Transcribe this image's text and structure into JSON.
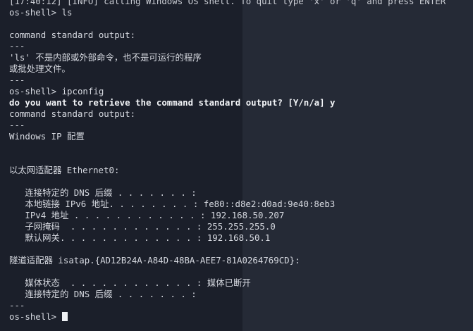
{
  "terminal": {
    "lines": [
      "[17:40:12] [INFO] calling Windows OS shell. To quit type 'x' or 'q' and press ENTER",
      "os-shell> ls",
      "",
      "command standard output:",
      "---",
      "'ls' 不是内部或外部命令，也不是可运行的程序",
      "或批处理文件。",
      "---",
      "os-shell> ipconfig",
      "do you want to retrieve the command standard output? [Y/n/a] y",
      "command standard output:",
      "---",
      "Windows IP 配置",
      "",
      "",
      "以太网适配器 Ethernet0:",
      "",
      "   连接特定的 DNS 后缀 . . . . . . . :",
      "   本地链接 IPv6 地址. . . . . . . . : fe80::d8e2:d0ad:9e40:8eb3",
      "   IPv4 地址 . . . . . . . . . . . . : 192.168.50.207",
      "   子网掩码  . . . . . . . . . . . . : 255.255.255.0",
      "   默认网关. . . . . . . . . . . . . : 192.168.50.1",
      "",
      "隧道适配器 isatap.{AD12B24A-A84D-48BA-AEE7-81A0264769CD}:",
      "",
      "   媒体状态  . . . . . . . . . . . . : 媒体已断开",
      "   连接特定的 DNS 后缀 . . . . . . . :",
      "---",
      "os-shell> "
    ]
  }
}
